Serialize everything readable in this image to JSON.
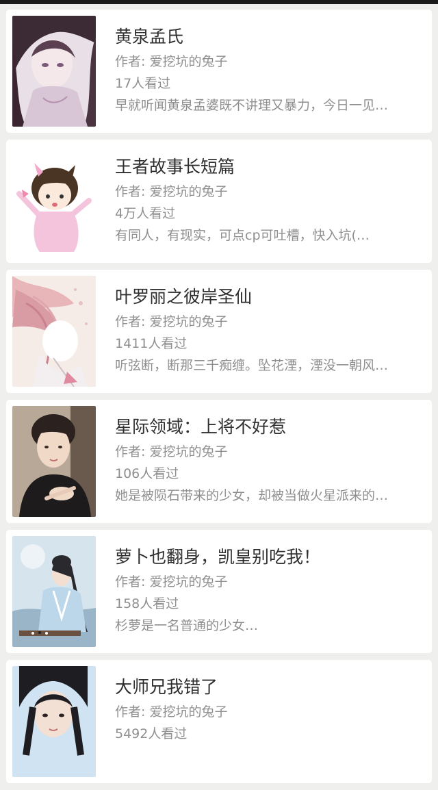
{
  "books": [
    {
      "cover": "anime-girl-illustration",
      "title": "黄泉孟氏",
      "author": "作者: 爱挖坑的兔子",
      "views": "17人看过",
      "desc": "早就听闻黄泉孟婆既不讲理又暴力，今日一见…"
    },
    {
      "cover": "chibi-girl-illustration",
      "title": "王者故事长短篇",
      "author": "作者: 爱挖坑的兔子",
      "views": "4万人看过",
      "desc": "有同人，有现实，可点cp可吐槽，快入坑(…"
    },
    {
      "cover": "pink-hair-fairy-illustration",
      "title": "叶罗丽之彼岸圣仙",
      "author": "作者: 爱挖坑的兔子",
      "views": "1411人看过",
      "desc": "听弦断，断那三千痴缠。坠花湮，湮没一朝风…"
    },
    {
      "cover": "young-man-photo",
      "title": "星际领域：上将不好惹",
      "author": "作者: 爱挖坑的兔子",
      "views": "106人看过",
      "desc": "她是被陨石带来的少女，却被当做火星派来的…"
    },
    {
      "cover": "costume-drama-photo",
      "title": "萝卜也翻身，凯皇别吃我！",
      "author": "作者: 爱挖坑的兔子",
      "views": "158人看过",
      "desc": "杉萝是一名普通的少女…"
    },
    {
      "cover": "ancient-costume-portrait",
      "title": "大师兄我错了",
      "author": "作者: 爱挖坑的兔子",
      "views": "5492人看过",
      "desc": ""
    }
  ]
}
